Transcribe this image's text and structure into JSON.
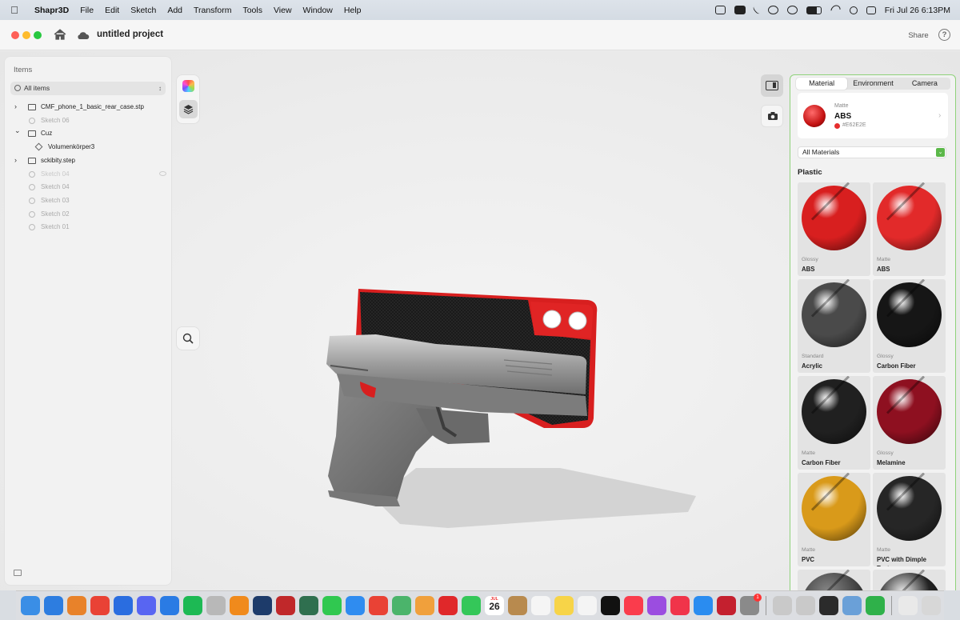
{
  "menubar": {
    "app_name": "Shapr3D",
    "menus": [
      "File",
      "Edit",
      "Sketch",
      "Add",
      "Transform",
      "Tools",
      "View",
      "Window",
      "Help"
    ],
    "clock": "Fri Jul 26  6:13PM"
  },
  "titlebar": {
    "project_title": "untitled project",
    "share_label": "Share",
    "help_label": "?"
  },
  "items_panel": {
    "title": "Items",
    "filter_label": "All items",
    "rows": [
      {
        "label": "CMF_phone_1_basic_rear_case.stp",
        "kind": "folder",
        "arrow": "›"
      },
      {
        "label": "Sketch 06",
        "kind": "sketch"
      },
      {
        "label": "Cuz",
        "kind": "folder",
        "arrow": "⌄"
      },
      {
        "label": "Volumenkörper3",
        "kind": "body"
      },
      {
        "label": "sckibity.step",
        "kind": "folder",
        "arrow": "›"
      },
      {
        "label": "Sketch 04",
        "kind": "sketch"
      },
      {
        "label": "Sketch 04",
        "kind": "sketch"
      },
      {
        "label": "Sketch 03",
        "kind": "sketch"
      },
      {
        "label": "Sketch 02",
        "kind": "sketch"
      },
      {
        "label": "Sketch 01",
        "kind": "sketch"
      }
    ]
  },
  "material_panel": {
    "tabs": [
      "Material",
      "Environment",
      "Camera"
    ],
    "active_tab": "Material",
    "current": {
      "type": "Matte",
      "name": "ABS",
      "hex": "#E62E2E",
      "color": "#e62e2e"
    },
    "filter_label": "All Materials",
    "category": "Plastic",
    "materials": [
      {
        "type": "Glossy",
        "name": "ABS",
        "color": "#d81f1f"
      },
      {
        "type": "Matte",
        "name": "ABS",
        "color": "#e22a2a"
      },
      {
        "type": "Standard",
        "name": "Acrylic",
        "color": "#4a4a4a"
      },
      {
        "type": "Glossy",
        "name": "Carbon Fiber",
        "color": "#161616"
      },
      {
        "type": "Matte",
        "name": "Carbon Fiber",
        "color": "#202020"
      },
      {
        "type": "Glossy",
        "name": "Melamine",
        "color": "#8e1020"
      },
      {
        "type": "Matte",
        "name": "PVC",
        "color": "#d99a1a"
      },
      {
        "type": "Matte",
        "name": "PVC with Dimple Texture",
        "color": "#262626"
      }
    ]
  },
  "dock": {
    "calendar_day": "26",
    "badge_count": "1",
    "icons": [
      {
        "name": "finder",
        "color": "#3a8ee6"
      },
      {
        "name": "safari",
        "color": "#2d7de0"
      },
      {
        "name": "blender",
        "color": "#e8822a"
      },
      {
        "name": "chrome",
        "color": "#e94235"
      },
      {
        "name": "vpn",
        "color": "#2a6de0"
      },
      {
        "name": "discord",
        "color": "#5865f2"
      },
      {
        "name": "c-app",
        "color": "#2a7be4"
      },
      {
        "name": "spotify",
        "color": "#1db954"
      },
      {
        "name": "roblox",
        "color": "#b8b8b8"
      },
      {
        "name": "fusion",
        "color": "#f08a1c"
      },
      {
        "name": "frame",
        "color": "#1d3b6a"
      },
      {
        "name": "f-gear",
        "color": "#c0282a"
      },
      {
        "name": "script",
        "color": "#2f6f4f"
      },
      {
        "name": "messages",
        "color": "#30c850"
      },
      {
        "name": "mail",
        "color": "#2f8cf0"
      },
      {
        "name": "chrome-2",
        "color": "#e94235"
      },
      {
        "name": "maps",
        "color": "#4bb46b"
      },
      {
        "name": "photos",
        "color": "#f0a03c"
      },
      {
        "name": "stamp",
        "color": "#e0282a"
      },
      {
        "name": "facetime",
        "color": "#34c759"
      },
      {
        "name": "calendar",
        "color": "#ffffff"
      },
      {
        "name": "brown-app",
        "color": "#b88a4e"
      },
      {
        "name": "reminders",
        "color": "#f5f5f5"
      },
      {
        "name": "notes",
        "color": "#f7d448"
      },
      {
        "name": "freeform",
        "color": "#f4f4f4"
      },
      {
        "name": "tv",
        "color": "#111111"
      },
      {
        "name": "music",
        "color": "#fa3c4c"
      },
      {
        "name": "podcasts",
        "color": "#9b4de0"
      },
      {
        "name": "news",
        "color": "#f0344a"
      },
      {
        "name": "appstore",
        "color": "#2a8cf0"
      },
      {
        "name": "autocad",
        "color": "#c4202f"
      },
      {
        "name": "settings",
        "color": "#8a8a8a"
      },
      {
        "name": "unknown-1",
        "color": "#c9c9c9"
      },
      {
        "name": "unknown-2",
        "color": "#c9c9c9"
      },
      {
        "name": "quicktime",
        "color": "#2b2b2b"
      },
      {
        "name": "preview",
        "color": "#6aa0d8"
      },
      {
        "name": "numbers",
        "color": "#2fb14a"
      },
      {
        "name": "folder",
        "color": "#e9e9e9"
      },
      {
        "name": "trash",
        "color": "#d7d7d7"
      }
    ]
  }
}
